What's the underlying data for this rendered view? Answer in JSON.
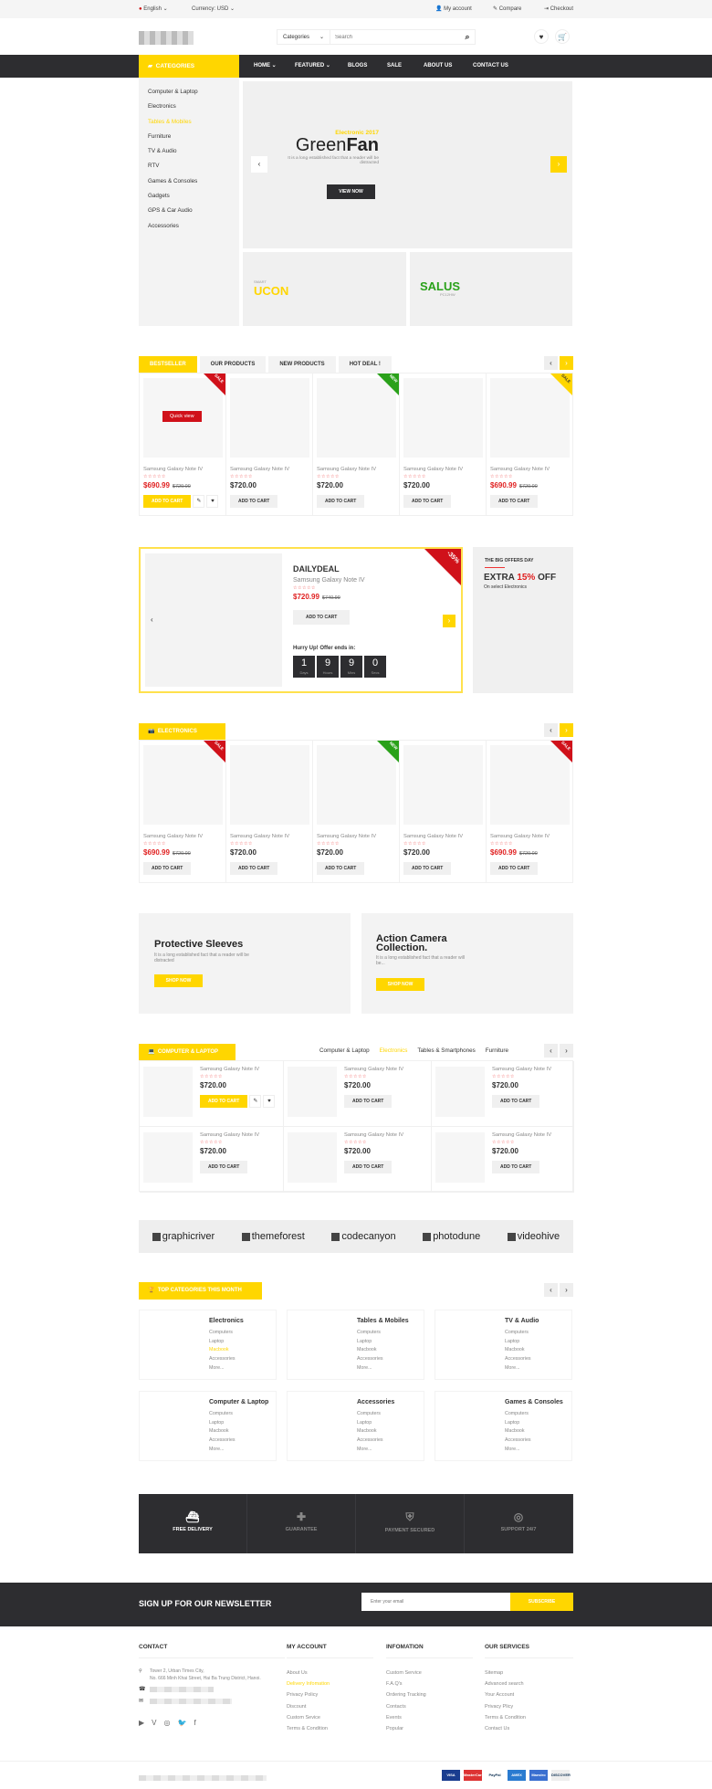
{
  "topbar": {
    "language": "English",
    "currency": "Currency: USD",
    "my_account": "My account",
    "compare": "Compare",
    "checkout": "Checkout"
  },
  "header": {
    "search_category": "Categories",
    "search_placeholder": "Search"
  },
  "nav": {
    "categories_label": "CATEGORIES",
    "items": [
      "HOME",
      "FEATURED",
      "BLOGS",
      "SALE",
      "ABOUT US",
      "CONTACT US"
    ]
  },
  "sidebar": {
    "items": [
      "Computer & Laptop",
      "Electronics",
      "Tables & Mobiles",
      "Furniture",
      "TV & Audio",
      "RTV",
      "Games & Consoles",
      "Gadgets",
      "GPS & Car Audio",
      "Accessories"
    ],
    "active_index": 2
  },
  "slider": {
    "kicker": "Electronic 2017",
    "title_light": "Green",
    "title_bold": "Fan",
    "text": "It is a long established fact that a reader will be distracted",
    "button": "VIEW NOW"
  },
  "mini_banners": [
    {
      "small": "SMART",
      "big": "UCON",
      "color": "#ffd600"
    },
    {
      "big": "SALUS",
      "small": "PC12HW",
      "color": "#2aa11a"
    }
  ],
  "tabs": {
    "items": [
      "BESTSELLER",
      "OUR PRODUCTS",
      "NEW PRODUCTS",
      "HOT DEAL !"
    ],
    "active_index": 0
  },
  "bestseller": [
    {
      "name": "Samsung Galaxy Note IV",
      "price": "$690.99",
      "old_price": "$720.00",
      "badge": "SALE",
      "badge_color": "#d0111a",
      "quick_view": "Quick view"
    },
    {
      "name": "Samsung Galaxy Note IV",
      "price": "$720.00"
    },
    {
      "name": "Samsung Galaxy Note IV",
      "price": "$720.00",
      "badge": "NEW",
      "badge_color": "#2aa11a"
    },
    {
      "name": "Samsung Galaxy Note IV",
      "price": "$720.00"
    },
    {
      "name": "Samsung Galaxy Note IV",
      "price": "$690.99",
      "old_price": "$720.00",
      "badge": "SALE",
      "badge_color": "#ffd600"
    }
  ],
  "add_to_cart": "ADD TO CART",
  "daily_deal": {
    "title": "DAILYDEAL",
    "name": "Samsung Galaxy Note IV",
    "price": "$720.99",
    "old_price": "$740.99",
    "discount": "-35%",
    "button": "ADD TO CART",
    "hurry": "Hurry Up! Offer ends in:",
    "countdown": [
      {
        "v": "1",
        "u": "Days"
      },
      {
        "v": "9",
        "u": "Hours"
      },
      {
        "v": "9",
        "u": "Mins"
      },
      {
        "v": "0",
        "u": "Secs"
      }
    ]
  },
  "offer": {
    "kicker": "THE BIG OFFERS DAY",
    "pre": "EXTRA ",
    "pct": "15%",
    "post": " OFF",
    "sub": "On select Electronics"
  },
  "electronics": {
    "title": "ELECTRONICS",
    "products": [
      {
        "name": "Samsung Galaxy Note IV",
        "price": "$690.99",
        "old_price": "$720.00",
        "badge": "SALE",
        "badge_color": "#d0111a"
      },
      {
        "name": "Samsung Galaxy Note IV",
        "price": "$720.00"
      },
      {
        "name": "Samsung Galaxy Note IV",
        "price": "$720.00",
        "badge": "NEW",
        "badge_color": "#2aa11a"
      },
      {
        "name": "Samsung Galaxy Note IV",
        "price": "$720.00"
      },
      {
        "name": "Samsung Galaxy Note IV",
        "price": "$690.99",
        "old_price": "$720.00",
        "badge": "SALE",
        "badge_color": "#d0111a"
      }
    ]
  },
  "promo_banners": [
    {
      "title": "Protective Sleeves",
      "text": "It is a long established fact that a reader will be distracted",
      "button": "SHOP NOW"
    },
    {
      "title": "Action Camera Collection.",
      "text": "It is a long established fact that a reader will be...",
      "button": "SHOP NOW"
    }
  ],
  "computer_laptop": {
    "title": "COMPUTER & LAPTOP",
    "tabs": [
      "Computer & Laptop",
      "Electronics",
      "Tables & Smartphones",
      "Furniture"
    ],
    "active_tab": 1,
    "products": [
      {
        "name": "Samsung Galaxy Note IV",
        "price": "$720.00"
      },
      {
        "name": "Samsung Galaxy Note IV",
        "price": "$720.00"
      },
      {
        "name": "Samsung Galaxy Note IV",
        "price": "$720.00"
      },
      {
        "name": "Samsung Galaxy Note IV",
        "price": "$720.00"
      },
      {
        "name": "Samsung Galaxy Note IV",
        "price": "$720.00"
      },
      {
        "name": "Samsung Galaxy Note IV",
        "price": "$720.00"
      }
    ]
  },
  "brands": [
    "graphicriver",
    "themeforest",
    "codecanyon",
    "photodune",
    "videohive"
  ],
  "top_categories": {
    "title": "TOP CATEGORIES THIS MONTH",
    "boxes": [
      {
        "title": "Electronics",
        "links": [
          "Computers",
          "Laptop",
          "Macbook",
          "Accessories",
          "More..."
        ],
        "active": 2
      },
      {
        "title": "Tables & Mobiles",
        "links": [
          "Computers",
          "Laptop",
          "Macbook",
          "Accessories",
          "More..."
        ]
      },
      {
        "title": "TV & Audio",
        "links": [
          "Computers",
          "Laptop",
          "Macbook",
          "Accessories",
          "More..."
        ]
      },
      {
        "title": "Computer & Laptop",
        "links": [
          "Computers",
          "Laptop",
          "Macbook",
          "Accessories",
          "More..."
        ]
      },
      {
        "title": "Accessories",
        "links": [
          "Computers",
          "Laptop",
          "Macbook",
          "Accessories",
          "More..."
        ]
      },
      {
        "title": "Games & Consoles",
        "links": [
          "Computers",
          "Laptop",
          "Macbook",
          "Accessories",
          "More..."
        ]
      }
    ]
  },
  "services": [
    {
      "label": "FREE DELIVERY",
      "icon": "ship-icon"
    },
    {
      "label": "GUARANTEE",
      "icon": "medkit-icon"
    },
    {
      "label": "PAYMENT SECURED",
      "icon": "shield-icon"
    },
    {
      "label": "SUPPORT 24/7",
      "icon": "lifebuoy-icon"
    }
  ],
  "newsletter": {
    "title": "SIGN UP FOR OUR NEWSLETTER",
    "placeholder": "Enter your email",
    "button": "SUBSCRIBE"
  },
  "footer": {
    "contact": {
      "title": "CONTACT",
      "address_1": "Tower 2, Urban Times City,",
      "address_2": "No. 666 Minh Khai Street,  Hai Ba Trung District, Hanoi."
    },
    "columns": [
      {
        "title": "MY ACCOUNT",
        "links": [
          "About Us",
          "Delivery Infomation",
          "Privacy Policy",
          "Discount",
          "Custom Sevice",
          "Terms & Condition"
        ],
        "active": 1
      },
      {
        "title": "INFOMATION",
        "links": [
          "Custom Service",
          "F.A.Q's",
          "Ordering Tracking",
          "Contacts",
          "Events",
          "Popular"
        ]
      },
      {
        "title": "OUR SERVICES",
        "links": [
          "Sitemap",
          "Advanced search",
          "Your Account",
          "Privacy Plicy",
          "Terms & Condition",
          "Contact Us"
        ]
      }
    ],
    "payments": [
      "VISA",
      "MasterCard",
      "PayPal",
      "AMEX",
      "Maestro",
      "DISCOVER"
    ]
  },
  "colors": {
    "accent": "#ffd600",
    "dark": "#2d2d30",
    "sale": "#e02020"
  }
}
